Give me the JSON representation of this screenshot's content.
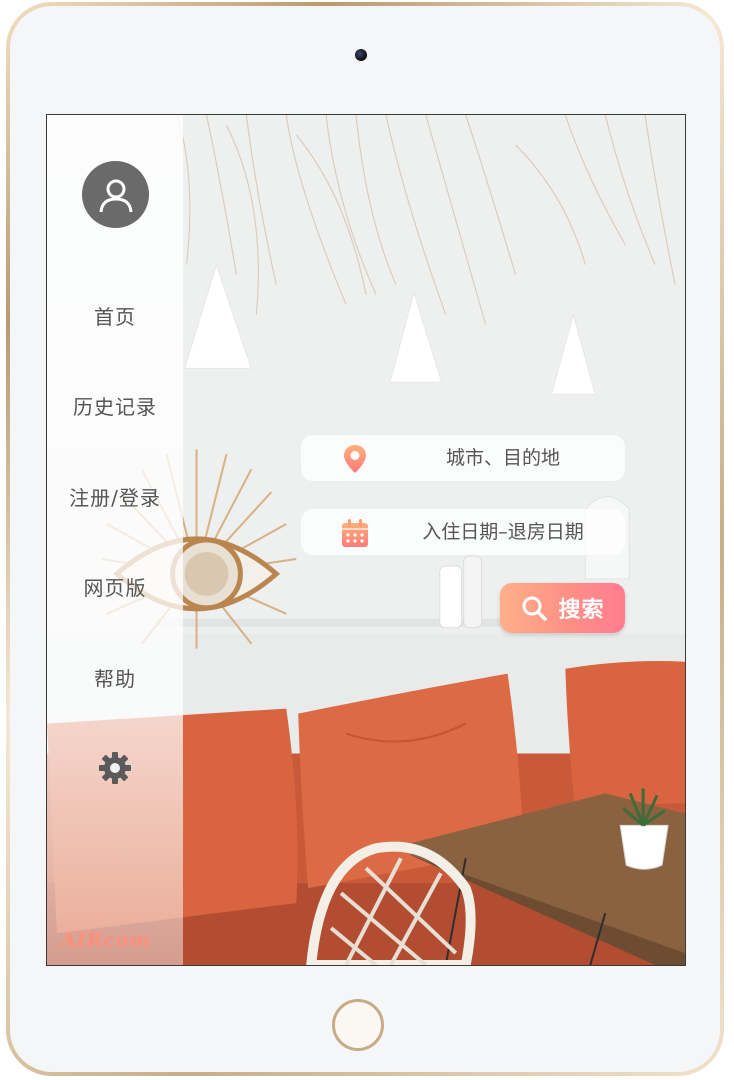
{
  "sidebar": {
    "items": [
      {
        "label": "首页"
      },
      {
        "label": "历史记录"
      },
      {
        "label": "注册/登录"
      },
      {
        "label": "网页版"
      },
      {
        "label": "帮助"
      }
    ],
    "logo_text": "AIRcom"
  },
  "search": {
    "destination_placeholder": "城市、目的地",
    "dates_placeholder": "入住日期–退房日期",
    "button_label": "搜索"
  },
  "colors": {
    "accent_gradient_start": "#ffb08a",
    "accent_gradient_end": "#ff7d8f",
    "sidebar_text": "#555555",
    "cushion": "#d8653f"
  },
  "icons": {
    "avatar": "user-icon",
    "destination": "location-pin-icon",
    "dates": "calendar-icon",
    "search": "search-icon",
    "settings": "gear-icon"
  }
}
